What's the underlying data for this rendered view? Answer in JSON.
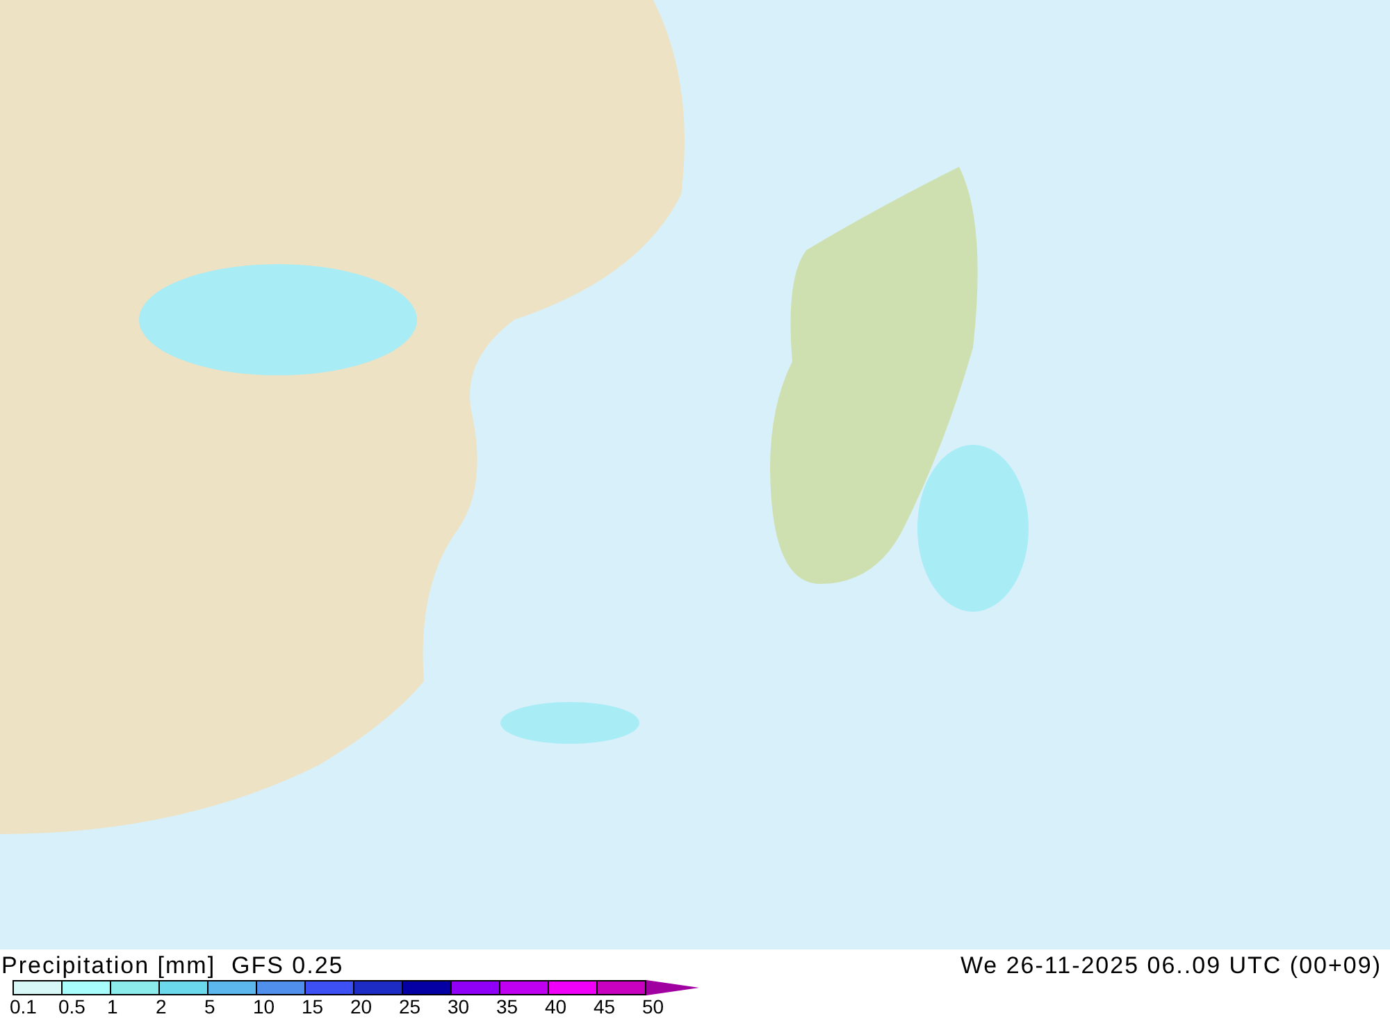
{
  "title": "Precipitation [mm]  GFS 0.25",
  "valid_time": "We 26-11-2025 06..09 UTC (00+09)",
  "legend": {
    "swatches": [
      {
        "color": "#d8f8f8"
      },
      {
        "color": "#a8fcfc"
      },
      {
        "color": "#8cecec"
      },
      {
        "color": "#6cd8ec"
      },
      {
        "color": "#5cb8ec"
      },
      {
        "color": "#5090ec"
      },
      {
        "color": "#3c50f4"
      },
      {
        "color": "#1c2cc4"
      },
      {
        "color": "#0400a4"
      },
      {
        "color": "#9000f8"
      },
      {
        "color": "#c000f0"
      },
      {
        "color": "#f000f8"
      },
      {
        "color": "#c800c0"
      }
    ],
    "arrow": {
      "color": "#a000a0"
    },
    "labels": [
      "0.1",
      "0.5",
      "1",
      "2",
      "5",
      "10",
      "15",
      "20",
      "25",
      "30",
      "35",
      "40",
      "45",
      "50"
    ]
  }
}
